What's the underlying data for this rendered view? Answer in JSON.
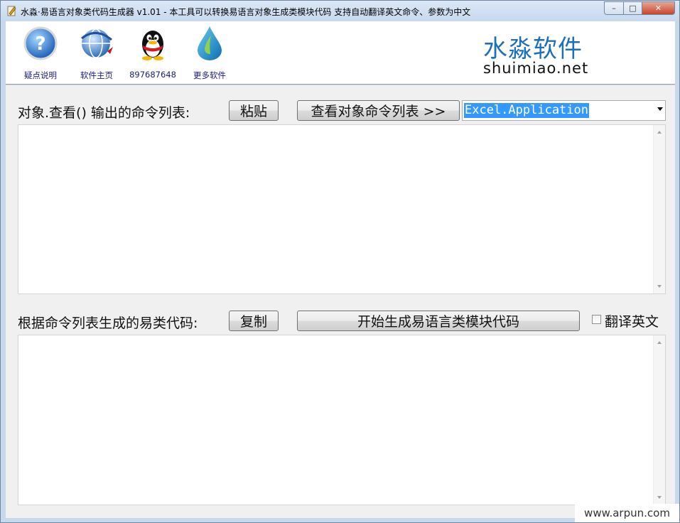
{
  "window": {
    "title": "水淼·易语言对象类代码生成器 v1.01 - 本工具可以转换易语言对象生成类模块代码 支持自动翻译英文命令、参数为中文",
    "buttons": {
      "minimize": "–",
      "maximize": "□",
      "close": "✕"
    }
  },
  "toolbar": [
    {
      "label": "疑点说明",
      "icon": "help-question-icon"
    },
    {
      "label": "软件主页",
      "icon": "globe-icon"
    },
    {
      "label": "897687648",
      "icon": "qq-penguin-icon"
    },
    {
      "label": "更多软件",
      "icon": "water-drop-icon"
    }
  ],
  "brand": {
    "name_cn": "水淼软件",
    "name_en": "shuimiao.net",
    "color": "#1e6fb8"
  },
  "top_section": {
    "label": "对象.查看() 输出的命令列表:",
    "paste_button": "粘贴",
    "view_button": "查看对象命令列表 >>",
    "object_select": {
      "value": "Excel.Application"
    },
    "output_text": ""
  },
  "bottom_section": {
    "label": "根据命令列表生成的易类代码:",
    "copy_button": "复制",
    "generate_button": "开始生成易语言类模块代码",
    "translate_checkbox": {
      "label": "翻译英文",
      "checked": false
    },
    "code_text": ""
  },
  "watermark": "www.arpun.com",
  "colors": {
    "selection": "#3399ff",
    "title_bar": "#c9d9ec",
    "close_button": "#c7442c"
  }
}
